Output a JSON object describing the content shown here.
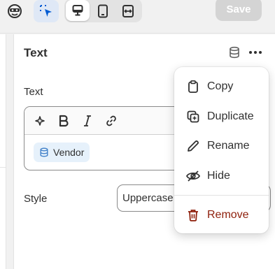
{
  "toolbar": {
    "save_label": "Save",
    "icons": [
      "theme-icon",
      "selector-icon",
      "desktop-icon",
      "mobile-icon",
      "fullwidth-icon"
    ]
  },
  "panel": {
    "title": "Text",
    "text_label": "Text",
    "tag_label": "Vendor",
    "style_label": "Style",
    "style_value": "Uppercase"
  },
  "menu": {
    "items": [
      {
        "label": "Copy",
        "icon": "clipboard-icon"
      },
      {
        "label": "Duplicate",
        "icon": "duplicate-icon"
      },
      {
        "label": "Rename",
        "icon": "pencil-icon"
      },
      {
        "label": "Hide",
        "icon": "eye-slash-icon"
      },
      {
        "label": "Remove",
        "icon": "trash-icon"
      }
    ]
  },
  "colors": {
    "danger": "#8e1f0b",
    "selector_accent": "#005bd3",
    "tag_bg": "#e6f1fb"
  }
}
